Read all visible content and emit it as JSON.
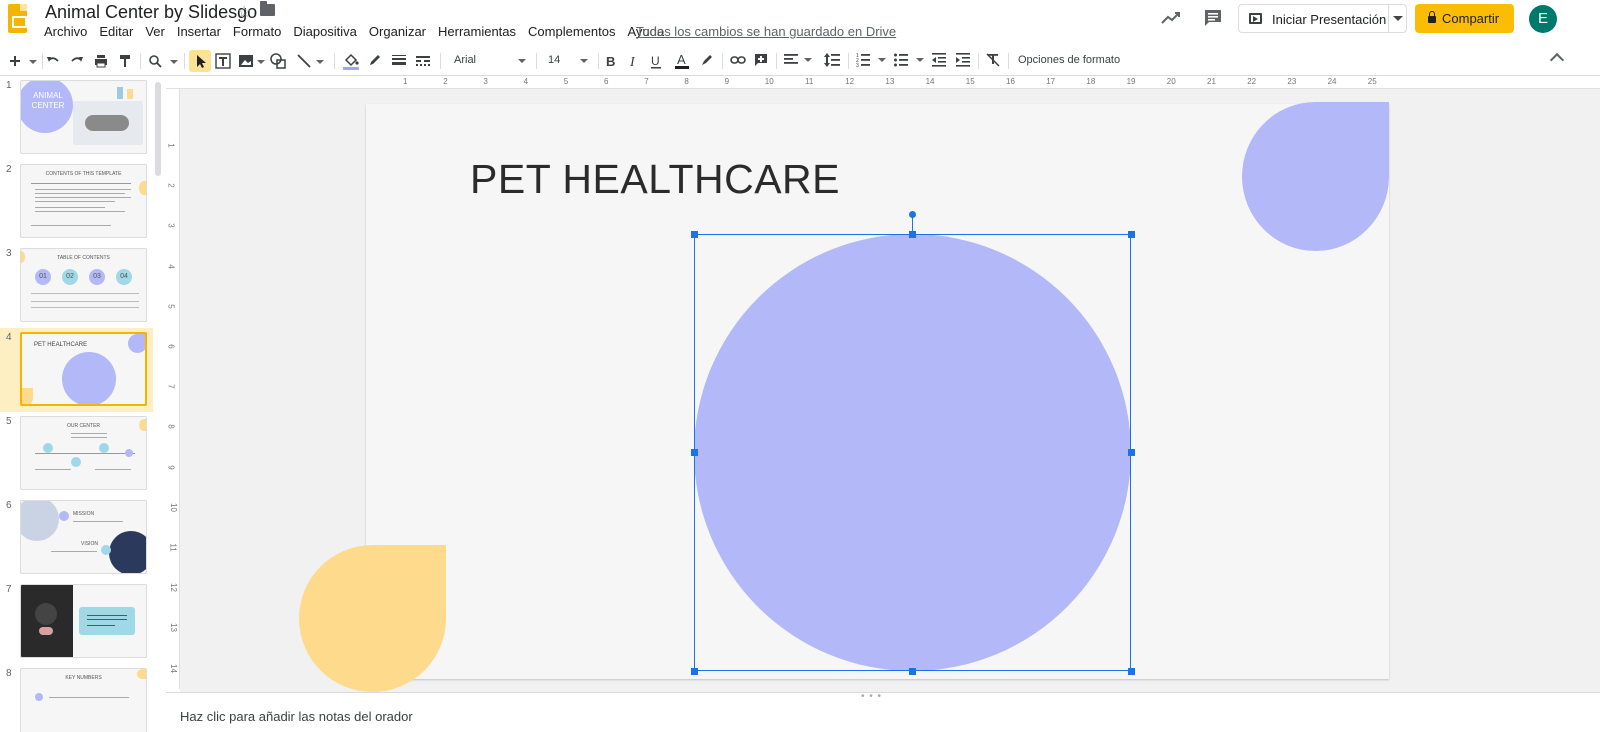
{
  "app": {
    "title": "Animal Center by Slidesgo",
    "saved_status": "Todos los cambios se han guardado en Drive",
    "menu": [
      "Archivo",
      "Editar",
      "Ver",
      "Insertar",
      "Formato",
      "Diapositiva",
      "Organizar",
      "Herramientas",
      "Complementos",
      "Ayuda"
    ],
    "present_label": "Iniciar Presentación",
    "share_label": "Compartir",
    "avatar_letter": "E"
  },
  "toolbar": {
    "font": "Arial",
    "font_size": "14",
    "format_options": "Opciones de formato"
  },
  "filmstrip": {
    "slides": [
      {
        "num": "1",
        "title": "ANIMAL CENTER"
      },
      {
        "num": "2",
        "title": "CONTENTS OF THIS TEMPLATE"
      },
      {
        "num": "3",
        "title": "TABLE OF CONTENTS",
        "items": [
          "01",
          "02",
          "03",
          "04"
        ]
      },
      {
        "num": "4",
        "title": "PET HEALTHCARE"
      },
      {
        "num": "5",
        "title": "OUR CENTER"
      },
      {
        "num": "6",
        "title": "MISSION",
        "subtitle": "VISION"
      },
      {
        "num": "7",
        "title": ""
      },
      {
        "num": "8",
        "title": "KEY NUMBERS"
      }
    ]
  },
  "ruler": {
    "top": [
      "1",
      "2",
      "3",
      "4",
      "5",
      "6",
      "7",
      "8",
      "9",
      "10",
      "11",
      "12",
      "13",
      "14",
      "15",
      "16",
      "17",
      "18",
      "19",
      "20",
      "21",
      "22",
      "23",
      "24",
      "25"
    ],
    "left": [
      "1",
      "2",
      "3",
      "4",
      "5",
      "6",
      "7",
      "8",
      "9",
      "10",
      "11",
      "12",
      "13",
      "14"
    ]
  },
  "slide": {
    "title": "PET HEALTHCARE"
  },
  "notes": {
    "placeholder": "Haz clic para añadir las notas del orador"
  },
  "colors": {
    "accent_yellow": "#fbbc04",
    "circle_purple": "#b3b8f8",
    "drop_yellow": "#fedb8c",
    "selection_blue": "#1a73e8"
  }
}
